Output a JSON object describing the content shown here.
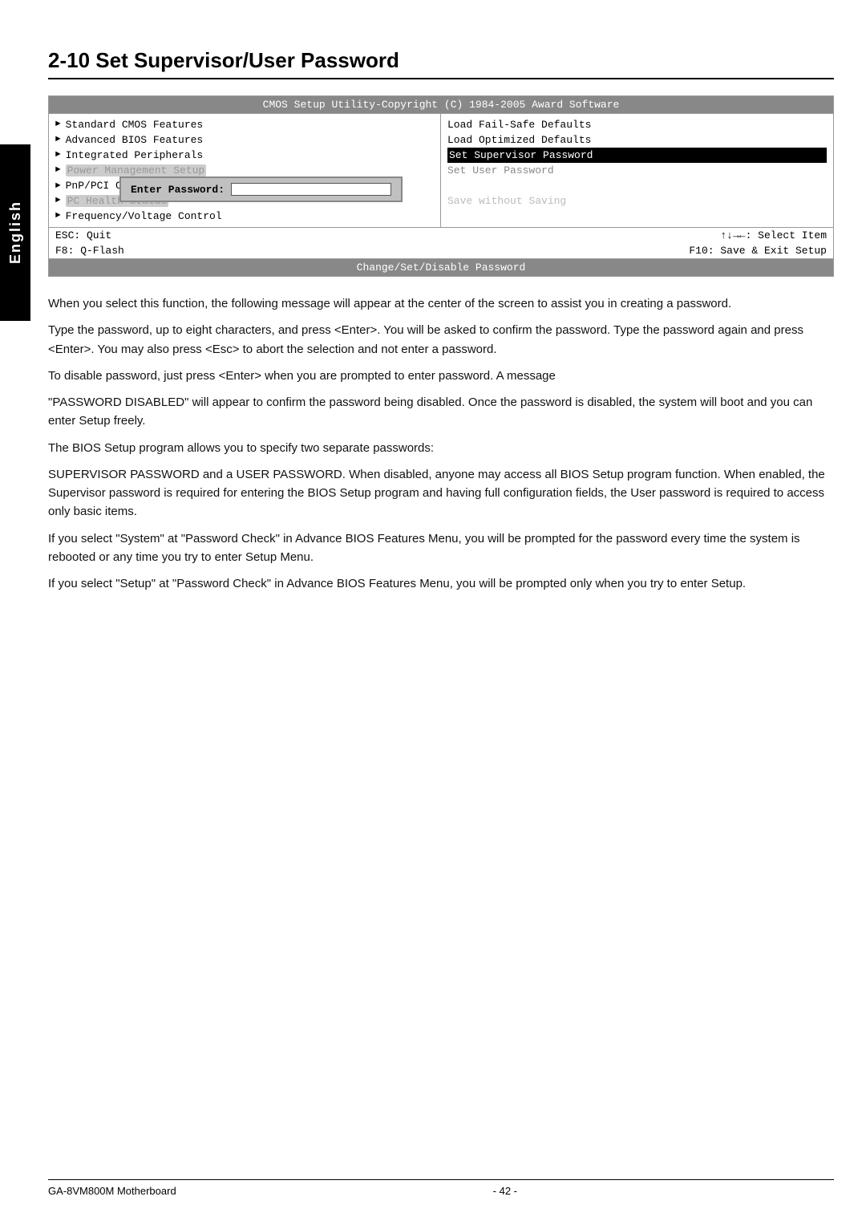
{
  "sidebar": {
    "label": "English"
  },
  "page": {
    "title": "2-10  Set Supervisor/User Password"
  },
  "bios": {
    "header": "CMOS Setup Utility-Copyright (C) 1984-2005 Award Software",
    "left_items": [
      {
        "arrow": true,
        "text": "Standard CMOS Features"
      },
      {
        "arrow": true,
        "text": "Advanced BIOS Features"
      },
      {
        "arrow": true,
        "text": "Integrated Peripherals"
      },
      {
        "arrow": true,
        "text": "Power Management Setup",
        "partial": true
      },
      {
        "arrow": true,
        "text": "PnP/PCI C",
        "partial": true,
        "dialog": true
      },
      {
        "arrow": true,
        "text": "PC Health Status",
        "partial": true
      },
      {
        "arrow": true,
        "text": "Frequency/Voltage Control"
      }
    ],
    "right_items": [
      {
        "text": "Load Fail-Safe Defaults",
        "style": "normal"
      },
      {
        "text": "Load Optimized Defaults",
        "style": "normal"
      },
      {
        "text": "Set Supervisor Password",
        "style": "highlighted"
      },
      {
        "text": "Set User Password",
        "style": "partial"
      },
      {
        "text": "",
        "style": "normal"
      },
      {
        "text": "Save without Saving",
        "style": "faded"
      },
      {
        "text": "",
        "style": "normal"
      }
    ],
    "dialog": {
      "label": "Enter Password:",
      "input_value": ""
    },
    "footer": {
      "left1": "ESC: Quit",
      "right1": "↑↓→←: Select Item",
      "left2": "F8: Q-Flash",
      "right2": "F10: Save & Exit Setup"
    },
    "footer_bottom": "Change/Set/Disable Password"
  },
  "body_paragraphs": [
    "When you select this function, the following message will appear at the center of the screen to assist you in creating a password.",
    "Type the password, up to eight characters, and press <Enter>. You will be asked to confirm the password. Type the password again and press <Enter>. You may also press <Esc> to abort the selection and not enter a password.",
    "To disable password, just press <Enter> when you are prompted to enter password. A message",
    "\"PASSWORD DISABLED\" will appear to confirm the password being disabled. Once the password is disabled, the system will boot and you can enter Setup freely.",
    "The BIOS Setup program allows you to specify two separate passwords:",
    "SUPERVISOR PASSWORD and a USER PASSWORD. When disabled, anyone may access all BIOS Setup program function. When enabled, the Supervisor password is required for entering the BIOS Setup program and having full configuration fields, the User password is required to access only basic items.",
    "If you select \"System\" at \"Password Check\" in Advance BIOS Features Menu, you will be prompted for the password every time the system is rebooted or any time you try to enter Setup Menu.",
    "If you select \"Setup\" at \"Password Check\" in Advance BIOS Features Menu, you will be prompted only when you try to enter Setup."
  ],
  "footer": {
    "left": "GA-8VM800M Motherboard",
    "center": "- 42 -",
    "right": ""
  }
}
